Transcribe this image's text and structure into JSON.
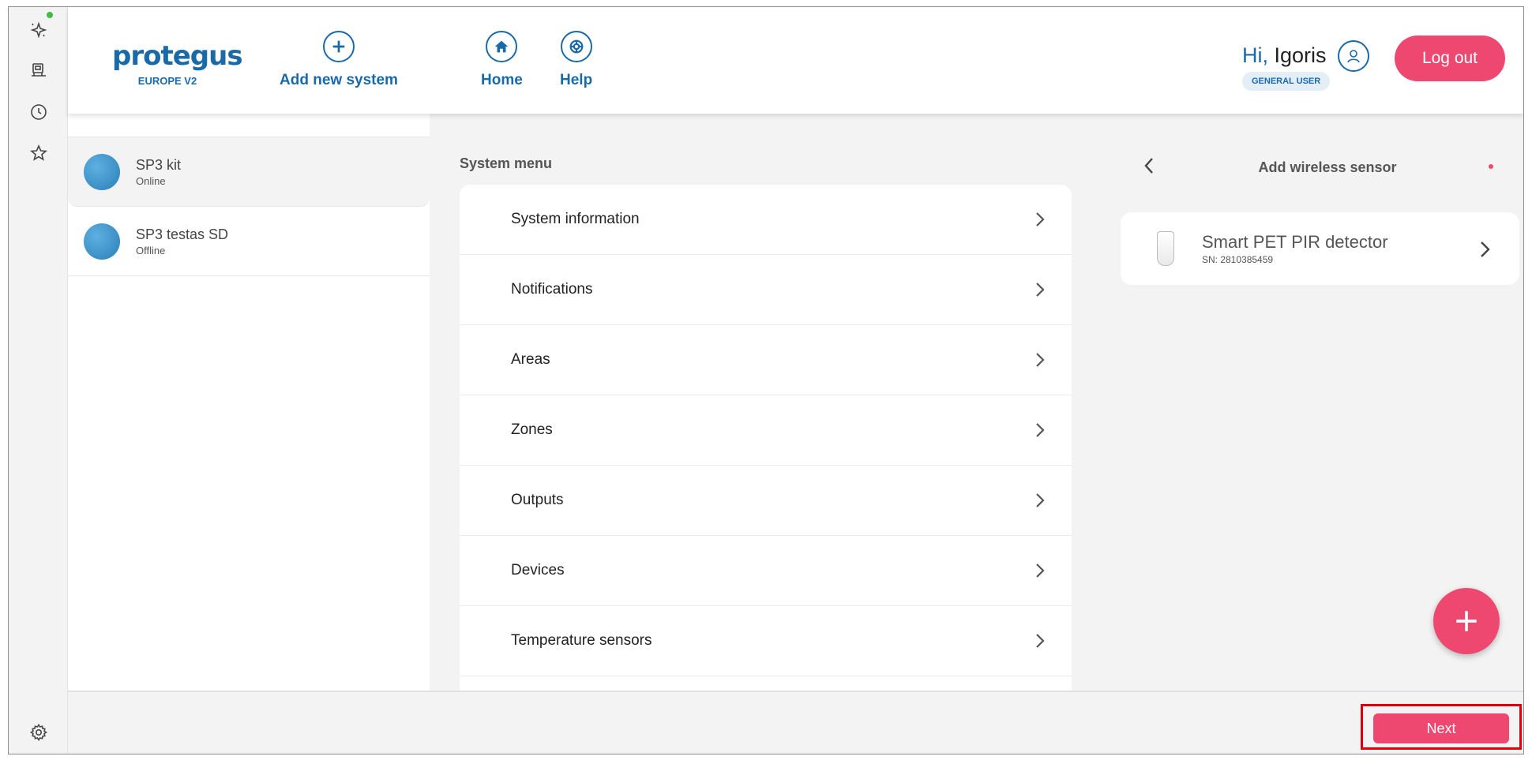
{
  "brand": {
    "name": "protegus",
    "region": "EUROPE V2"
  },
  "nav": {
    "add_system": "Add new system",
    "home": "Home",
    "help": "Help"
  },
  "user": {
    "hi": "Hi,",
    "name": "Igoris",
    "role": "GENERAL USER",
    "logout": "Log out"
  },
  "systems": [
    {
      "name": "SP3 kit",
      "status": "Online"
    },
    {
      "name": "SP3 testas SD",
      "status": "Offline"
    }
  ],
  "system_menu": {
    "title": "System menu",
    "items": [
      "System information",
      "Notifications",
      "Areas",
      "Zones",
      "Outputs",
      "Devices",
      "Temperature sensors"
    ]
  },
  "wireless": {
    "title": "Add wireless sensor",
    "sensor": {
      "name": "Smart PET PIR detector",
      "sn": "SN: 2810385459"
    }
  },
  "footer": {
    "next": "Next"
  },
  "colors": {
    "accent": "#ef4870",
    "brand": "#1a6aa8",
    "online_dot": "#3fbf3f"
  },
  "icons": {
    "rail": [
      "sparkle-icon",
      "device-icon",
      "clock-icon",
      "star-icon",
      "gear-icon"
    ],
    "nav": [
      "plus-circle-icon",
      "home-icon",
      "lifebuoy-icon"
    ]
  }
}
